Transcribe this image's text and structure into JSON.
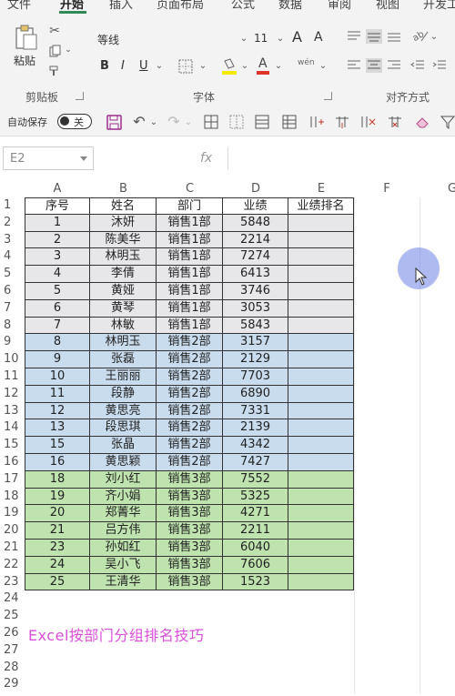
{
  "menu_tabs": [
    "文件",
    "开始",
    "插入",
    "页面布局",
    "公式",
    "数据",
    "审阅",
    "视图",
    "开发工"
  ],
  "active_tab": "开始",
  "ribbon": {
    "paste_label": "粘贴",
    "font_name": "等线",
    "font_size": "11",
    "bold": "B",
    "italic": "I",
    "underline": "U",
    "phonetic": "wén",
    "group_clipboard": "剪贴板",
    "group_font": "字体",
    "group_alignment": "对齐方式",
    "increase_font_icon": "A",
    "decrease_font_icon": "A"
  },
  "quick_access": {
    "autosave_label": "自动保存",
    "autosave_state": "关"
  },
  "formula_bar": {
    "name_box": "E2",
    "fx": "fx",
    "value": ""
  },
  "columns": [
    "A",
    "B",
    "C",
    "D",
    "E",
    "F",
    "G"
  ],
  "headers": [
    "序号",
    "姓名",
    "部门",
    "业绩",
    "业绩排名"
  ],
  "rows": [
    {
      "no": "1",
      "name": "沐妍",
      "dept": "销售1部",
      "score": "5848",
      "rank": "",
      "group": 1
    },
    {
      "no": "2",
      "name": "陈美华",
      "dept": "销售1部",
      "score": "2214",
      "rank": "",
      "group": 1
    },
    {
      "no": "3",
      "name": "林明玉",
      "dept": "销售1部",
      "score": "7274",
      "rank": "",
      "group": 1
    },
    {
      "no": "4",
      "name": "李倩",
      "dept": "销售1部",
      "score": "6413",
      "rank": "",
      "group": 1
    },
    {
      "no": "5",
      "name": "黄娅",
      "dept": "销售1部",
      "score": "3746",
      "rank": "",
      "group": 1
    },
    {
      "no": "6",
      "name": "黄琴",
      "dept": "销售1部",
      "score": "3053",
      "rank": "",
      "group": 1
    },
    {
      "no": "7",
      "name": "林敏",
      "dept": "销售1部",
      "score": "5843",
      "rank": "",
      "group": 1
    },
    {
      "no": "8",
      "name": "林明玉",
      "dept": "销售2部",
      "score": "3157",
      "rank": "",
      "group": 2
    },
    {
      "no": "9",
      "name": "张磊",
      "dept": "销售2部",
      "score": "2129",
      "rank": "",
      "group": 2
    },
    {
      "no": "10",
      "name": "王丽丽",
      "dept": "销售2部",
      "score": "7703",
      "rank": "",
      "group": 2
    },
    {
      "no": "11",
      "name": "段静",
      "dept": "销售2部",
      "score": "6890",
      "rank": "",
      "group": 2
    },
    {
      "no": "12",
      "name": "黄思亮",
      "dept": "销售2部",
      "score": "7331",
      "rank": "",
      "group": 2
    },
    {
      "no": "13",
      "name": "段思琪",
      "dept": "销售2部",
      "score": "2139",
      "rank": "",
      "group": 2
    },
    {
      "no": "15",
      "name": "张晶",
      "dept": "销售2部",
      "score": "4342",
      "rank": "",
      "group": 2
    },
    {
      "no": "16",
      "name": "黄思颖",
      "dept": "销售2部",
      "score": "7427",
      "rank": "",
      "group": 2
    },
    {
      "no": "18",
      "name": "刘小红",
      "dept": "销售3部",
      "score": "7552",
      "rank": "",
      "group": 3
    },
    {
      "no": "19",
      "name": "齐小娟",
      "dept": "销售3部",
      "score": "5325",
      "rank": "",
      "group": 3
    },
    {
      "no": "20",
      "name": "郑菁华",
      "dept": "销售3部",
      "score": "4271",
      "rank": "",
      "group": 3
    },
    {
      "no": "21",
      "name": "吕方伟",
      "dept": "销售3部",
      "score": "2211",
      "rank": "",
      "group": 3
    },
    {
      "no": "23",
      "name": "孙如红",
      "dept": "销售3部",
      "score": "6040",
      "rank": "",
      "group": 3
    },
    {
      "no": "24",
      "name": "吴小飞",
      "dept": "销售3部",
      "score": "7606",
      "rank": "",
      "group": 3
    },
    {
      "no": "25",
      "name": "王清华",
      "dept": "销售3部",
      "score": "1523",
      "rank": "",
      "group": 3
    }
  ],
  "row_numbers": [
    "1",
    "2",
    "3",
    "4",
    "5",
    "6",
    "7",
    "8",
    "9",
    "10",
    "11",
    "12",
    "13",
    "14",
    "15",
    "16",
    "17",
    "18",
    "19",
    "20",
    "21",
    "22",
    "23",
    "24",
    "25",
    "26",
    "27",
    "28",
    "29"
  ],
  "caption_text": "Excel按部门分组排名技巧",
  "colors": {
    "group1": "#e7e7ea",
    "group2": "#c9dced",
    "group3": "#bfe3ae",
    "caption": "#d94fd8",
    "accent": "#2e8b57"
  }
}
